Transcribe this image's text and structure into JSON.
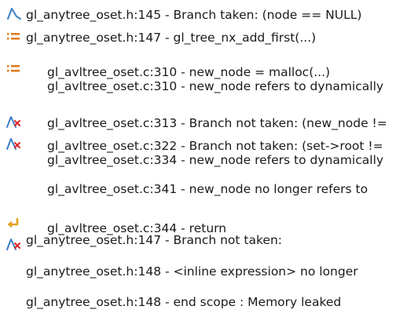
{
  "trace": {
    "events": [
      {
        "icon": "branch-taken-icon",
        "text": "gl_anytree_oset.h:145 - Branch taken: (node == NULL)"
      },
      {
        "icon": "list-event-icon",
        "text": "gl_anytree_oset.h:147 - gl_tree_nx_add_first(...)"
      },
      {
        "icon": "list-event-icon",
        "text": "gl_avltree_oset.c:310 - new_node = malloc(...)"
      },
      {
        "icon": null,
        "text": "gl_avltree_oset.c:310 - new_node refers to dynamically"
      },
      {
        "icon": "branch-not-taken-icon",
        "text": "gl_avltree_oset.c:313 - Branch not taken: (new_node !="
      },
      {
        "icon": "branch-not-taken-icon",
        "text": "gl_avltree_oset.c:322 - Branch not taken: (set->root !="
      },
      {
        "icon": null,
        "text": "gl_avltree_oset.c:334 - new_node refers to dynamically"
      },
      {
        "icon": null,
        "text": "gl_avltree_oset.c:341 - new_node no longer refers to"
      },
      {
        "icon": "return-arrow-icon",
        "text": "gl_avltree_oset.c:344 - return"
      },
      {
        "icon": "branch-not-taken-icon",
        "text": "gl_anytree_oset.h:147 - Branch not taken:"
      },
      {
        "icon": null,
        "text": "gl_anytree_oset.h:148 - <inline expression> no longer"
      },
      {
        "icon": null,
        "text": "gl_anytree_oset.h:148 - end scope : Memory leaked"
      }
    ]
  },
  "colors": {
    "text": "#1a1a1a",
    "branch_icon": "#3a7fc4",
    "list_icon": "#e0781e",
    "not_taken_mark": "#e02424",
    "return_icon": "#e0a21e"
  }
}
